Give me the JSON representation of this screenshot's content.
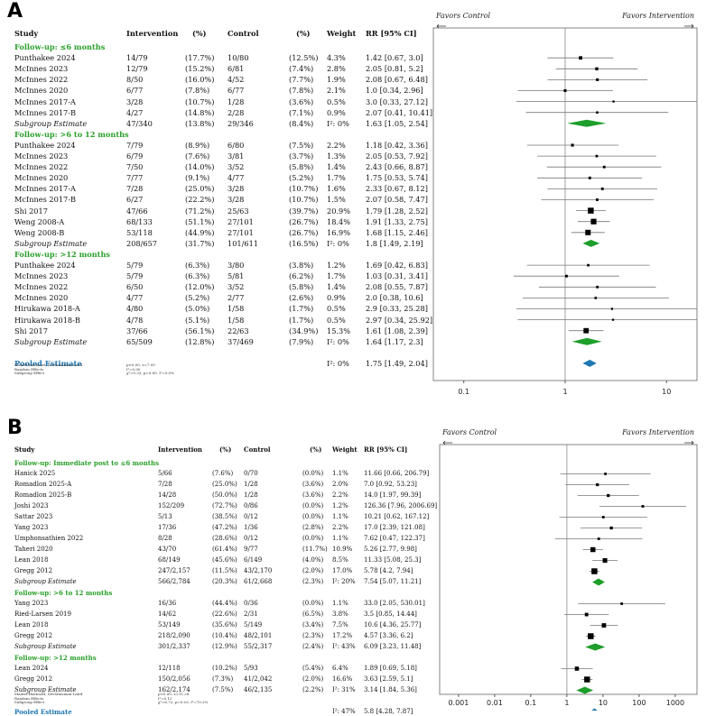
{
  "panels": [
    {
      "letter": "A",
      "headers": {
        "study": "Study",
        "intervention": "Intervention",
        "ipct": "(%)",
        "control": "Control",
        "cpct": "(%)",
        "weight": "Weight",
        "rr": "RR [95% CI]"
      },
      "favors_left": "Favors Control",
      "favors_right": "Favors Intervention",
      "rows": [
        {
          "type": "group",
          "label": "Follow-up: ≤6 months"
        },
        {
          "type": "study",
          "study": "Punthakee 2024",
          "i": "14/79",
          "ip": "(17.7%)",
          "c": "10/80",
          "cp": "(12.5%)",
          "w": "4.3%",
          "rr": "1.42 [0.67, 3.0]",
          "est": 1.42,
          "lo": 0.67,
          "hi": 3.0,
          "wt": 4.3
        },
        {
          "type": "study",
          "study": "McInnes 2023",
          "i": "12/79",
          "ip": "(15.2%)",
          "c": "6/81",
          "cp": "(7.4%)",
          "w": "2.8%",
          "rr": "2.05 [0.81, 5.2]",
          "est": 2.05,
          "lo": 0.81,
          "hi": 5.2,
          "wt": 2.8
        },
        {
          "type": "study",
          "study": "McInnes 2022",
          "i": "8/50",
          "ip": "(16.0%)",
          "c": "4/52",
          "cp": "(7.7%)",
          "w": "1.9%",
          "rr": "2.08 [0.67, 6.48]",
          "est": 2.08,
          "lo": 0.67,
          "hi": 6.48,
          "wt": 1.9
        },
        {
          "type": "study",
          "study": "McInnes 2020",
          "i": "6/77",
          "ip": "(7.8%)",
          "c": "6/77",
          "cp": "(7.8%)",
          "w": "2.1%",
          "rr": "1.0 [0.34, 2.96]",
          "est": 1.0,
          "lo": 0.34,
          "hi": 2.96,
          "wt": 2.1
        },
        {
          "type": "study",
          "study": "McInnes 2017-A",
          "i": "3/28",
          "ip": "(10.7%)",
          "c": "1/28",
          "cp": "(3.6%)",
          "w": "0.5%",
          "rr": "3.0 [0.33, 27.12]",
          "est": 3.0,
          "lo": 0.33,
          "hi": 27.12,
          "wt": 0.5
        },
        {
          "type": "study",
          "study": "McInnes 2017-B",
          "i": "4/27",
          "ip": "(14.8%)",
          "c": "2/28",
          "cp": "(7.1%)",
          "w": "0.9%",
          "rr": "2.07 [0.41, 10.41]",
          "est": 2.07,
          "lo": 0.41,
          "hi": 10.41,
          "wt": 0.9
        },
        {
          "type": "subtotal",
          "study": "Subgroup Estimate",
          "i": "47/340",
          "ip": "(13.8%)",
          "c": "29/346",
          "cp": "(8.4%)",
          "w": "I²: 0%",
          "rr": "1.63 [1.05, 2.54]",
          "est": 1.63,
          "lo": 1.05,
          "hi": 2.54
        },
        {
          "type": "group",
          "label": "Follow-up: >6 to 12 months"
        },
        {
          "type": "study",
          "study": "Punthakee 2024",
          "i": "7/79",
          "ip": "(8.9%)",
          "c": "6/80",
          "cp": "(7.5%)",
          "w": "2.2%",
          "rr": "1.18 [0.42, 3.36]",
          "est": 1.18,
          "lo": 0.42,
          "hi": 3.36,
          "wt": 2.2
        },
        {
          "type": "study",
          "study": "McInnes 2023",
          "i": "6/79",
          "ip": "(7.6%)",
          "c": "3/81",
          "cp": "(3.7%)",
          "w": "1.3%",
          "rr": "2.05 [0.53, 7.92]",
          "est": 2.05,
          "lo": 0.53,
          "hi": 7.92,
          "wt": 1.3
        },
        {
          "type": "study",
          "study": "McInnes 2022",
          "i": "7/50",
          "ip": "(14.0%)",
          "c": "3/52",
          "cp": "(5.8%)",
          "w": "1.4%",
          "rr": "2.43 [0.66, 8.87]",
          "est": 2.43,
          "lo": 0.66,
          "hi": 8.87,
          "wt": 1.4
        },
        {
          "type": "study",
          "study": "McInnes 2020",
          "i": "7/77",
          "ip": "(9.1%)",
          "c": "4/77",
          "cp": "(5.2%)",
          "w": "1.7%",
          "rr": "1.75 [0.53, 5.74]",
          "est": 1.75,
          "lo": 0.53,
          "hi": 5.74,
          "wt": 1.7
        },
        {
          "type": "study",
          "study": "McInnes 2017-A",
          "i": "7/28",
          "ip": "(25.0%)",
          "c": "3/28",
          "cp": "(10.7%)",
          "w": "1.6%",
          "rr": "2.33 [0.67, 8.12]",
          "est": 2.33,
          "lo": 0.67,
          "hi": 8.12,
          "wt": 1.6
        },
        {
          "type": "study",
          "study": "McInnes 2017-B",
          "i": "6/27",
          "ip": "(22.2%)",
          "c": "3/28",
          "cp": "(10.7%)",
          "w": "1.5%",
          "rr": "2.07 [0.58, 7.47]",
          "est": 2.07,
          "lo": 0.58,
          "hi": 7.47,
          "wt": 1.5
        },
        {
          "type": "study",
          "study": "Shi 2017",
          "i": "47/66",
          "ip": "(71.2%)",
          "c": "25/63",
          "cp": "(39.7%)",
          "w": "20.9%",
          "rr": "1.79 [1.28, 2.52]",
          "est": 1.79,
          "lo": 1.28,
          "hi": 2.52,
          "wt": 20.9
        },
        {
          "type": "study",
          "study": "Weng 2008-A",
          "i": "68/133",
          "ip": "(51.1%)",
          "c": "27/101",
          "cp": "(26.7%)",
          "w": "18.4%",
          "rr": "1.91 [1.33, 2.75]",
          "est": 1.91,
          "lo": 1.33,
          "hi": 2.75,
          "wt": 18.4
        },
        {
          "type": "study",
          "study": "Weng 2008-B",
          "i": "53/118",
          "ip": "(44.9%)",
          "c": "27/101",
          "cp": "(26.7%)",
          "w": "16.9%",
          "rr": "1.68 [1.15, 2.46]",
          "est": 1.68,
          "lo": 1.15,
          "hi": 2.46,
          "wt": 16.9
        },
        {
          "type": "subtotal",
          "study": "Subgroup Estimate",
          "i": "208/657",
          "ip": "(31.7%)",
          "c": "101/611",
          "cp": "(16.5%)",
          "w": "I²: 0%",
          "rr": "1.8 [1.49, 2.19]",
          "est": 1.8,
          "lo": 1.49,
          "hi": 2.19
        },
        {
          "type": "group",
          "label": "Follow-up: >12 months"
        },
        {
          "type": "study",
          "study": "Punthakee 2024",
          "i": "5/79",
          "ip": "(6.3%)",
          "c": "3/80",
          "cp": "(3.8%)",
          "w": "1.2%",
          "rr": "1.69 [0.42, 6.83]",
          "est": 1.69,
          "lo": 0.42,
          "hi": 6.83,
          "wt": 1.2
        },
        {
          "type": "study",
          "study": "McInnes 2023",
          "i": "5/79",
          "ip": "(6.3%)",
          "c": "5/81",
          "cp": "(6.2%)",
          "w": "1.7%",
          "rr": "1.03 [0.31, 3.41]",
          "est": 1.03,
          "lo": 0.31,
          "hi": 3.41,
          "wt": 1.7
        },
        {
          "type": "study",
          "study": "McInnes 2022",
          "i": "6/50",
          "ip": "(12.0%)",
          "c": "3/52",
          "cp": "(5.8%)",
          "w": "1.4%",
          "rr": "2.08 [0.55, 7.87]",
          "est": 2.08,
          "lo": 0.55,
          "hi": 7.87,
          "wt": 1.4
        },
        {
          "type": "study",
          "study": "McInnes 2020",
          "i": "4/77",
          "ip": "(5.2%)",
          "c": "2/77",
          "cp": "(2.6%)",
          "w": "0.9%",
          "rr": "2.0 [0.38, 10.6]",
          "est": 2.0,
          "lo": 0.38,
          "hi": 10.6,
          "wt": 0.9
        },
        {
          "type": "study",
          "study": "Hirukawa 2018-A",
          "i": "4/80",
          "ip": "(5.0%)",
          "c": "1/58",
          "cp": "(1.7%)",
          "w": "0.5%",
          "rr": "2.9 [0.33, 25.28]",
          "est": 2.9,
          "lo": 0.33,
          "hi": 25.28,
          "wt": 0.5
        },
        {
          "type": "study",
          "study": "Hirukawa 2018-B",
          "i": "4/78",
          "ip": "(5.1%)",
          "c": "1/58",
          "cp": "(1.7%)",
          "w": "0.5%",
          "rr": "2.97 [0.34, 25.92]",
          "est": 2.97,
          "lo": 0.34,
          "hi": 25.92,
          "wt": 0.5
        },
        {
          "type": "study",
          "study": "Shi 2017",
          "i": "37/66",
          "ip": "(56.1%)",
          "c": "22/63",
          "cp": "(34.9%)",
          "w": "15.3%",
          "rr": "1.61 [1.08, 2.39]",
          "est": 1.61,
          "lo": 1.08,
          "hi": 2.39,
          "wt": 15.3
        },
        {
          "type": "subtotal",
          "study": "Subgroup Estimate",
          "i": "65/509",
          "ip": "(12.8%)",
          "c": "37/469",
          "cp": "(7.9%)",
          "w": "I²: 0%",
          "rr": "1.64 [1.17, 2.3]",
          "est": 1.64,
          "lo": 1.17,
          "hi": 2.3
        },
        {
          "type": "pooled",
          "study": "Pooled Estimate",
          "w": "I²: 0%",
          "rr": "1.75 [1.49, 2.04]",
          "est": 1.75,
          "lo": 1.49,
          "hi": 2.04
        }
      ],
      "notes": [
        "Mantel-Haenszel, DerSimonian-Laird",
        "Random Effects",
        "Subgroup Effect"
      ],
      "notes_right": [
        "p<0.00, z=7.09",
        "I²=0.00",
        "χ²=0.33, p=0.85, I²=0.0%"
      ],
      "axis": {
        "scale": "log",
        "xlim": [
          0.05,
          20
        ],
        "ticks": [
          0.1,
          1,
          10
        ],
        "tick_labels": [
          "0.1",
          "1",
          "10"
        ]
      }
    },
    {
      "letter": "B",
      "headers": {
        "study": "Study",
        "intervention": "Intervention",
        "ipct": "(%)",
        "control": "Control",
        "cpct": "(%)",
        "weight": "Weight",
        "rr": "RR [95% CI]"
      },
      "favors_left": "Favors Control",
      "favors_right": "Favors Intervention",
      "rows": [
        {
          "type": "group",
          "label": "Follow-up: Immediate post to ≤6 months"
        },
        {
          "type": "study",
          "study": "Hanick 2025",
          "i": "5/66",
          "ip": "(7.6%)",
          "c": "0/70",
          "cp": "(0.0%)",
          "w": "1.1%",
          "rr": "11.66 [0.66, 206.79]",
          "est": 11.66,
          "lo": 0.66,
          "hi": 206.79,
          "wt": 1.1
        },
        {
          "type": "study",
          "study": "Romadlon 2025-A",
          "i": "7/28",
          "ip": "(25.0%)",
          "c": "1/28",
          "cp": "(3.6%)",
          "w": "2.0%",
          "rr": "7.0 [0.92, 53.23]",
          "est": 7.0,
          "lo": 0.92,
          "hi": 53.23,
          "wt": 2.0
        },
        {
          "type": "study",
          "study": "Romadlon 2025-B",
          "i": "14/28",
          "ip": "(50.0%)",
          "c": "1/28",
          "cp": "(3.6%)",
          "w": "2.2%",
          "rr": "14.0 [1.97, 99.39]",
          "est": 14.0,
          "lo": 1.97,
          "hi": 99.39,
          "wt": 2.2
        },
        {
          "type": "study",
          "study": "Joshi 2023",
          "i": "152/209",
          "ip": "(72.7%)",
          "c": "0/86",
          "cp": "(0.0%)",
          "w": "1.2%",
          "rr": "126.36 [7.96, 2006.69]",
          "est": 126.36,
          "lo": 7.96,
          "hi": 2006.69,
          "wt": 1.2
        },
        {
          "type": "study",
          "study": "Sattar 2023",
          "i": "5/13",
          "ip": "(38.5%)",
          "c": "0/12",
          "cp": "(0.0%)",
          "w": "1.1%",
          "rr": "10.21 [0.62, 167.12]",
          "est": 10.21,
          "lo": 0.62,
          "hi": 167.12,
          "wt": 1.1
        },
        {
          "type": "study",
          "study": "Yang 2023",
          "i": "17/36",
          "ip": "(47.2%)",
          "c": "1/36",
          "cp": "(2.8%)",
          "w": "2.2%",
          "rr": "17.0 [2.39, 121.08]",
          "est": 17.0,
          "lo": 2.39,
          "hi": 121.08,
          "wt": 2.2
        },
        {
          "type": "study",
          "study": "Umphonsathien 2022",
          "i": "8/28",
          "ip": "(28.6%)",
          "c": "0/12",
          "cp": "(0.0%)",
          "w": "1.1%",
          "rr": "7.62 [0.47, 122.37]",
          "est": 7.62,
          "lo": 0.47,
          "hi": 122.37,
          "wt": 1.1
        },
        {
          "type": "study",
          "study": "Taheri 2020",
          "i": "43/70",
          "ip": "(61.4%)",
          "c": "9/77",
          "cp": "(11.7%)",
          "w": "10.9%",
          "rr": "5.26 [2.77, 9.98]",
          "est": 5.26,
          "lo": 2.77,
          "hi": 9.98,
          "wt": 10.9
        },
        {
          "type": "study",
          "study": "Lean 2018",
          "i": "68/149",
          "ip": "(45.6%)",
          "c": "6/149",
          "cp": "(4.0%)",
          "w": "8.5%",
          "rr": "11.33 [5.08, 25.3]",
          "est": 11.33,
          "lo": 5.08,
          "hi": 25.3,
          "wt": 8.5
        },
        {
          "type": "study",
          "study": "Gregg 2012",
          "i": "247/2,157",
          "ip": "(11.5%)",
          "c": "43/2,170",
          "cp": "(2.0%)",
          "w": "17.0%",
          "rr": "5.78 [4.2, 7.94]",
          "est": 5.78,
          "lo": 4.2,
          "hi": 7.94,
          "wt": 17.0
        },
        {
          "type": "subtotal",
          "study": "Subgroup Estimate",
          "i": "566/2,784",
          "ip": "(20.3%)",
          "c": "61/2,668",
          "cp": "(2.3%)",
          "w": "I²: 20%",
          "rr": "7.54 [5.07, 11.21]",
          "est": 7.54,
          "lo": 5.07,
          "hi": 11.21
        },
        {
          "type": "group",
          "label": "Follow-up: >6 to 12 months"
        },
        {
          "type": "study",
          "study": "Yang 2023",
          "i": "16/36",
          "ip": "(44.4%)",
          "c": "0/36",
          "cp": "(0.0%)",
          "w": "1.1%",
          "rr": "33.0 [2.05, 530.01]",
          "est": 33.0,
          "lo": 2.05,
          "hi": 530.01,
          "wt": 1.1
        },
        {
          "type": "study",
          "study": "Ried-Larsen 2019",
          "i": "14/62",
          "ip": "(22.6%)",
          "c": "2/31",
          "cp": "(6.5%)",
          "w": "3.8%",
          "rr": "3.5 [0.85, 14.44]",
          "est": 3.5,
          "lo": 0.85,
          "hi": 14.44,
          "wt": 3.8
        },
        {
          "type": "study",
          "study": "Lean 2018",
          "i": "53/149",
          "ip": "(35.6%)",
          "c": "5/149",
          "cp": "(3.4%)",
          "w": "7.5%",
          "rr": "10.6 [4.36, 25.77]",
          "est": 10.6,
          "lo": 4.36,
          "hi": 25.77,
          "wt": 7.5
        },
        {
          "type": "study",
          "study": "Gregg 2012",
          "i": "218/2,090",
          "ip": "(10.4%)",
          "c": "48/2,101",
          "cp": "(2.3%)",
          "w": "17.2%",
          "rr": "4.57 [3.36, 6.2]",
          "est": 4.57,
          "lo": 3.36,
          "hi": 6.2,
          "wt": 17.2
        },
        {
          "type": "subtotal",
          "study": "Subgroup Estimate",
          "i": "301/2,337",
          "ip": "(12.9%)",
          "c": "55/2,317",
          "cp": "(2.4%)",
          "w": "I²: 43%",
          "rr": "6.09 [3.23, 11.48]",
          "est": 6.09,
          "lo": 3.23,
          "hi": 11.48
        },
        {
          "type": "group",
          "label": "Follow-up: >12 months"
        },
        {
          "type": "study",
          "study": "Lean 2024",
          "i": "12/118",
          "ip": "(10.2%)",
          "c": "5/93",
          "cp": "(5.4%)",
          "w": "6.4%",
          "rr": "1.89 [0.69, 5.18]",
          "est": 1.89,
          "lo": 0.69,
          "hi": 5.18,
          "wt": 6.4
        },
        {
          "type": "study",
          "study": "Gregg 2012",
          "i": "150/2,056",
          "ip": "(7.3%)",
          "c": "41/2,042",
          "cp": "(2.0%)",
          "w": "16.6%",
          "rr": "3.63 [2.59, 5.1]",
          "est": 3.63,
          "lo": 2.59,
          "hi": 5.1,
          "wt": 16.6
        },
        {
          "type": "subtotal",
          "study": "Subgroup Estimate",
          "i": "162/2,174",
          "ip": "(7.5%)",
          "c": "46/2,135",
          "cp": "(2.2%)",
          "w": "I²: 31%",
          "rr": "3.14 [1.84, 5.36]",
          "est": 3.14,
          "lo": 1.84,
          "hi": 5.36
        },
        {
          "type": "pooled",
          "study": "Pooled Estimate",
          "w": "I²: 47%",
          "rr": "5.8 [4.28, 7.87]",
          "est": 5.8,
          "lo": 4.28,
          "hi": 7.87
        }
      ],
      "notes": [
        "Mantel-Haenszel, DerSimonian-Laird",
        "Random Effects",
        "Subgroup Effect"
      ],
      "notes_right": [
        "p<0.00, z=11.28",
        "I²=0.12",
        "χ²=6.72, p=0.03, I²=70.2%"
      ],
      "axis": {
        "scale": "log",
        "xlim": [
          0.0003,
          4000
        ],
        "ticks": [
          0.001,
          0.01,
          0.1,
          1,
          10,
          100,
          1000
        ],
        "tick_labels": [
          "0.001",
          "0.01",
          "0.1",
          "1",
          "10",
          "100",
          "1000"
        ]
      }
    }
  ],
  "chart_data": [
    {
      "type": "forest",
      "panel": "A",
      "scale": "log",
      "xlim": [
        0.05,
        20
      ],
      "ref_line": 1
    },
    {
      "type": "forest",
      "panel": "B",
      "scale": "log",
      "xlim": [
        0.0003,
        4000
      ],
      "ref_line": 1
    }
  ],
  "colors": {
    "group": "#2aa02a",
    "subgroup_diamond": "#1e9e2a",
    "pooled": "#1f77b4",
    "marker": "#000000"
  }
}
